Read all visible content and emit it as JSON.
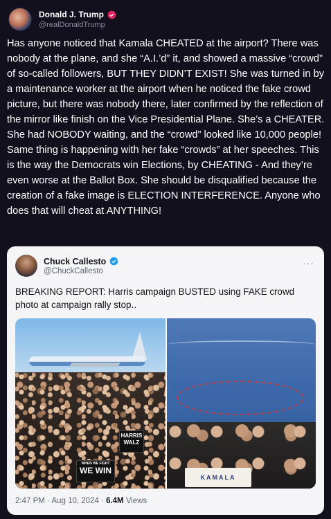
{
  "author": {
    "name": "Donald J. Trump",
    "handle": "@realDonaldTrump",
    "verified_color": "#e0245e"
  },
  "post": {
    "text": "Has anyone noticed that Kamala CHEATED at the airport? There was nobody at the plane, and she “A.I.’d” it, and showed a massive “crowd” of so-called followers, BUT THEY DIDN’T EXIST! She was turned in by a maintenance worker at the airport when he noticed the fake crowd picture, but there was nobody there, later confirmed by the reflection of the mirror like finish on the Vice Presidential Plane. She’s a CHEATER. She had NOBODY waiting, and the “crowd” looked like 10,000 people! Same thing is happening with her fake “crowds” at her speeches. This is the way the Democrats win Elections, by CHEATING - And they’re even worse at the Ballot Box. She should be disqualified because the creation of a fake image is ELECTION INTERFERENCE. Anyone who does that will cheat at ANYTHING!"
  },
  "quoted": {
    "name": "Chuck Callesto",
    "handle": "@ChuckCallesto",
    "verified_color": "#1d9bf0",
    "more_icon": "ellipsis-icon",
    "text": "BREAKING REPORT: Harris campaign BUSTED using FAKE crowd photo at campaign rally stop..",
    "photo_left": {
      "sign_harris_line1": "HARRIS",
      "sign_harris_line2": "WALZ",
      "sign_win_small": "WHEN WE FIGHT",
      "sign_win": "WE WIN"
    },
    "photo_right": {
      "sign_kamala": "KAMALA"
    },
    "timestamp": "2:47 PM · Aug 10, 2024 · ",
    "views_count": "6.4M",
    "views_label": " Views"
  }
}
